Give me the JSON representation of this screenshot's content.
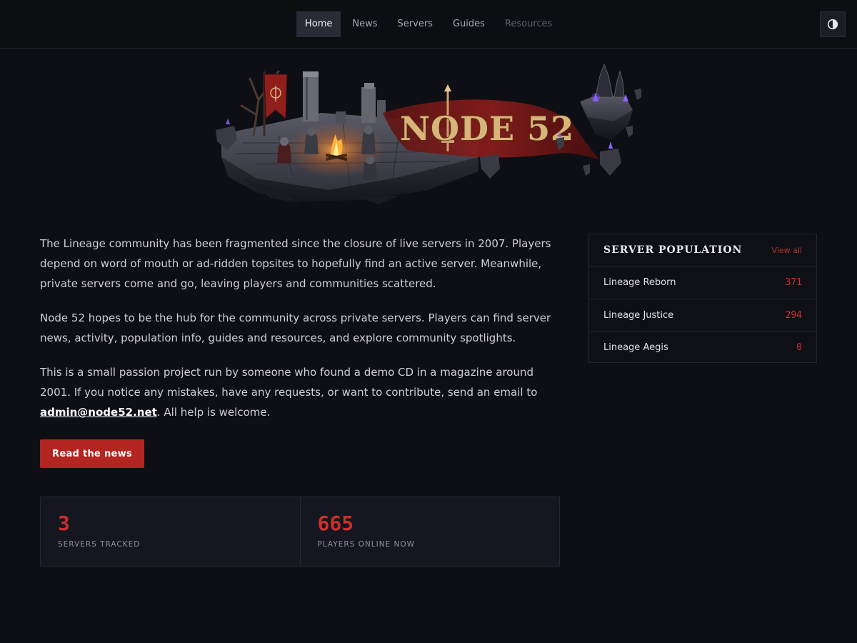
{
  "nav": {
    "items": [
      {
        "label": "Home",
        "state": "active"
      },
      {
        "label": "News",
        "state": "normal"
      },
      {
        "label": "Servers",
        "state": "normal"
      },
      {
        "label": "Guides",
        "state": "normal"
      },
      {
        "label": "Resources",
        "state": "dim"
      }
    ],
    "theme_toggle_icon": "contrast-icon"
  },
  "hero": {
    "brand": "NODE 52"
  },
  "intro": {
    "p1": "The Lineage community has been fragmented since the closure of live servers in 2007. Players depend on word of mouth or ad-ridden topsites to hopefully find an active server. Meanwhile, private servers come and go, leaving players and communities scattered.",
    "p2": "Node 52 hopes to be the hub for the community across private servers. Players can find server news, activity, population info, guides and resources, and explore community spotlights.",
    "p3_before": "This is a small passion project run by someone who found a demo CD in a magazine around 2001. If you notice any mistakes, have any requests, or want to contribute, send an email to ",
    "email": "admin@node52.net",
    "p3_after": ". All help is welcome.",
    "cta": "Read the news"
  },
  "stats": [
    {
      "value": "3",
      "label": "Servers tracked"
    },
    {
      "value": "665",
      "label": "Players online now"
    }
  ],
  "population": {
    "title": "Server Population",
    "view_all": "View all",
    "servers": [
      {
        "name": "Lineage Reborn",
        "count": "371"
      },
      {
        "name": "Lineage Justice",
        "count": "294"
      },
      {
        "name": "Lineage Aegis",
        "count": "0"
      }
    ]
  },
  "colors": {
    "accent": "#b32520",
    "background": "#0e0f14",
    "nav_active": "#2a2b37"
  }
}
